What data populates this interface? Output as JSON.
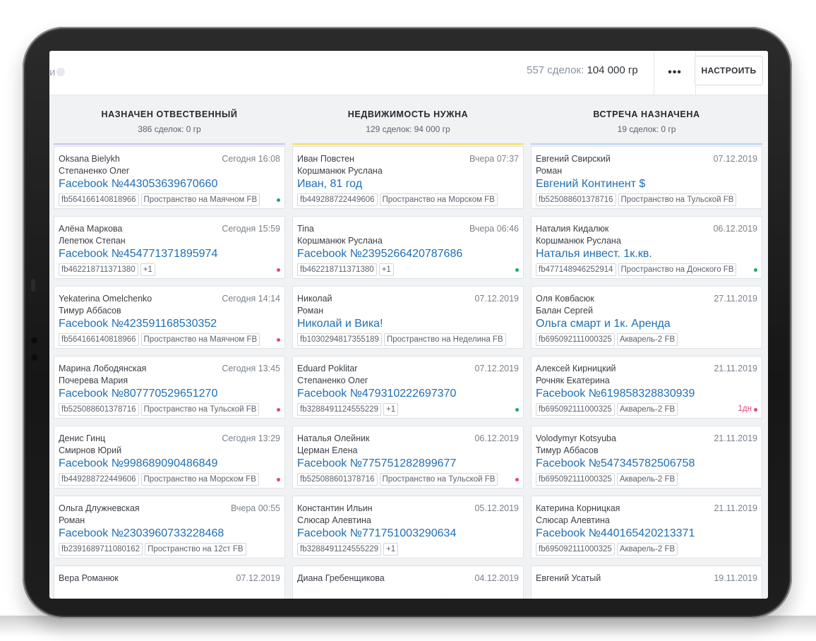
{
  "topbar": {
    "search_stub": "и",
    "deals_count": "557 сделок:",
    "deals_sum": "104 000 гр",
    "more_label": "•••",
    "setup_label": "НАСТРОИТЬ"
  },
  "colors": {
    "accent_link": "#1f6fb5",
    "dot_green": "#1ca862",
    "dot_pink": "#e7457a",
    "col1_line": "#c9c3ee",
    "col2_line": "#f4e04d",
    "col3_line": "#b9d3f3"
  },
  "columns": [
    {
      "title": "НАЗНАЧЕН ОТВЕСТВЕННЫЙ",
      "subtitle": "386 сделок: 0 гр",
      "cards": [
        {
          "name": "Oksana Bielykh",
          "date": "Сегодня 16:08",
          "resp": "Степаненко Олег",
          "title": "Facebook №443053639670660",
          "tags": [
            "fb564166140818966",
            "Пространство на Маячном FB"
          ],
          "dot": "green"
        },
        {
          "name": "Алёна Маркова",
          "date": "Сегодня 15:59",
          "resp": "Лепетюк Степан",
          "title": "Facebook №454771371895974",
          "tags": [
            "fb462218711371380",
            "+1"
          ],
          "dot": "pink"
        },
        {
          "name": "Yekaterina Omelchenko",
          "date": "Сегодня 14:14",
          "resp": "Тимур Аббасов",
          "title": "Facebook №423591168530352",
          "tags": [
            "fb564166140818966",
            "Пространство на Маячном FB"
          ],
          "dot": "pink"
        },
        {
          "name": "Марина Лободянская",
          "date": "Сегодня 13:45",
          "resp": "Почерева Мария",
          "title": "Facebook №807770529651270",
          "tags": [
            "fb525088601378716",
            "Пространство на Тульской FB"
          ],
          "dot": "pink"
        },
        {
          "name": "Денис Гинц",
          "date": "Сегодня 13:29",
          "resp": "Смирнов Юрий",
          "title": "Facebook №998689090486849",
          "tags": [
            "fb449288722449606",
            "Пространство на Морском FB"
          ],
          "dot": "pink"
        },
        {
          "name": "Ольга Длужневская",
          "date": "Вчера 00:55",
          "resp": "Роман",
          "title": "Facebook №2303960733228468",
          "tags": [
            "fb2391689711080162",
            "Пространство на 12ст FB"
          ],
          "dot": ""
        },
        {
          "name": "Вера Романюк",
          "date": "07.12.2019",
          "resp": "",
          "title": "",
          "tags": [],
          "dot": ""
        }
      ]
    },
    {
      "title": "НЕДВИЖИМОСТЬ НУЖНА",
      "subtitle": "129 сделок: 94 000 гр",
      "cards": [
        {
          "name": "Иван Повстен",
          "date": "Вчера 07:37",
          "resp": "Коршманюк Руслана",
          "title": "Иван, 81 год",
          "tags": [
            "fb449288722449606",
            "Пространство на Морском FB"
          ],
          "dot": ""
        },
        {
          "name": "Tina",
          "date": "Вчера 06:46",
          "resp": "Коршманюк Руслана",
          "title": "Facebook №2395266420787686",
          "tags": [
            "fb462218711371380",
            "+1"
          ],
          "dot": "green"
        },
        {
          "name": "Николай",
          "date": "07.12.2019",
          "resp": "Роман",
          "title": "Николай и Вика!",
          "tags": [
            "fb1030294817355189",
            "Пространство на Неделина FB"
          ],
          "dot": ""
        },
        {
          "name": "Eduard Poklitar",
          "date": "07.12.2019",
          "resp": "Степаненко Олег",
          "title": "Facebook №479310222697370",
          "tags": [
            "fb3288491124555229",
            "+1"
          ],
          "dot": "green"
        },
        {
          "name": "Наталья Олейник",
          "date": "06.12.2019",
          "resp": "Церман Елена",
          "title": "Facebook №775751282899677",
          "tags": [
            "fb525088601378716",
            "Пространство на Тульской FB"
          ],
          "dot": "pink"
        },
        {
          "name": "Константин Ильин",
          "date": "05.12.2019",
          "resp": "Слюсар Алевтина",
          "title": "Facebook №771751003290634",
          "tags": [
            "fb3288491124555229",
            "+1"
          ],
          "dot": ""
        },
        {
          "name": "Диана Гребенщикова",
          "date": "04.12.2019",
          "resp": "",
          "title": "",
          "tags": [],
          "dot": ""
        }
      ]
    },
    {
      "title": "ВСТРЕЧА НАЗНАЧЕНА",
      "subtitle": "19 сделок: 0 гр",
      "cards": [
        {
          "name": "Евгений Свирский",
          "date": "07.12.2019",
          "resp": "Роман",
          "title": "Евгений Континент $",
          "tags": [
            "fb525088601378716",
            "Пространство на Тульской FB"
          ],
          "dot": ""
        },
        {
          "name": "Наталия Кидалюк",
          "date": "06.12.2019",
          "resp": "Коршманюк Руслана",
          "title": "Наталья инвест. 1к.кв.",
          "tags": [
            "fb477148946252914",
            "Пространство на Донского FB"
          ],
          "dot": "green"
        },
        {
          "name": "Оля Ковбасюк",
          "date": "27.11.2019",
          "resp": "Балан Сергей",
          "title": "Ольга смарт и 1к. Аренда",
          "tags": [
            "fb695092111000325",
            "Акварель-2 FB"
          ],
          "dot": ""
        },
        {
          "name": "Алексей Кирницкий",
          "date": "21.11.2019",
          "resp": "Рочняк Екатерина",
          "title": "Facebook №619858328830939",
          "tags": [
            "fb695092111000325",
            "Акварель-2 FB"
          ],
          "dot": "pink",
          "status": "1дн"
        },
        {
          "name": "Volodymyr Kotsyuba",
          "date": "21.11.2019",
          "resp": "Тимур Аббасов",
          "title": "Facebook №547345782506758",
          "tags": [
            "fb695092111000325",
            "Акварель-2 FB"
          ],
          "dot": ""
        },
        {
          "name": "Катерина Корницкая",
          "date": "21.11.2019",
          "resp": "Слюсар Алевтина",
          "title": "Facebook №440165420213371",
          "tags": [
            "fb695092111000325",
            "Акварель-2 FB"
          ],
          "dot": ""
        },
        {
          "name": "Евгений Усатый",
          "date": "19.11.2019",
          "resp": "",
          "title": "",
          "tags": [],
          "dot": ""
        }
      ]
    }
  ]
}
